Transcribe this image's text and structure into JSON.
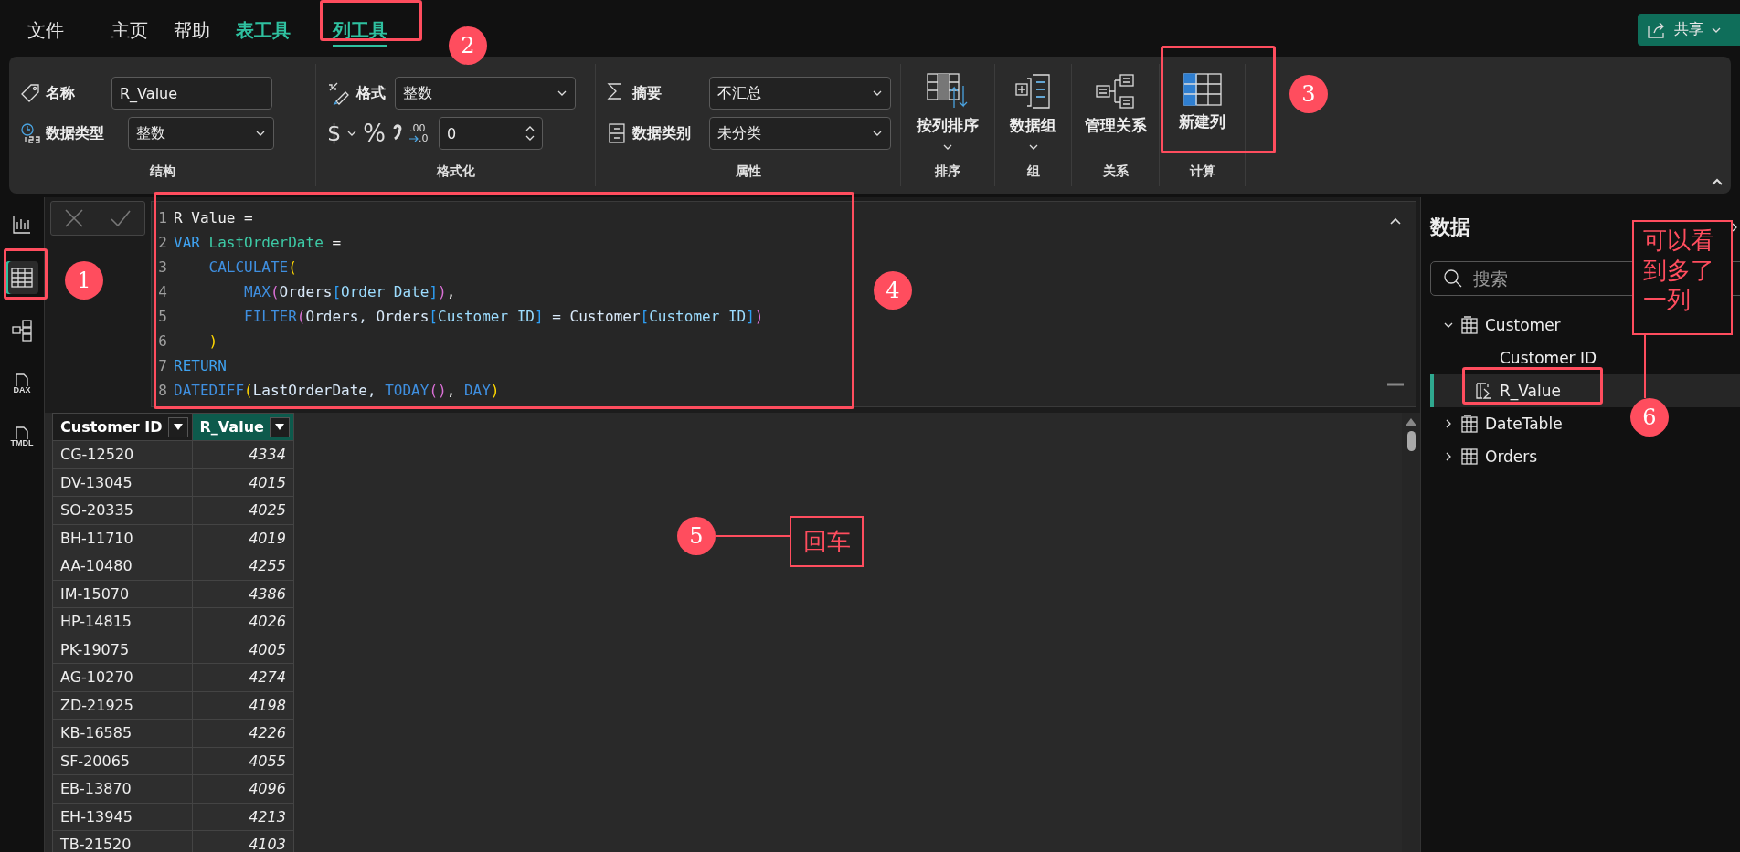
{
  "menu_tabs": [
    {
      "label": "文件",
      "kind": "plain",
      "selected": false
    },
    {
      "label": "主页",
      "kind": "plain",
      "selected": false
    },
    {
      "label": "帮助",
      "kind": "plain",
      "selected": false
    },
    {
      "label": "表工具",
      "kind": "context",
      "selected": false
    },
    {
      "label": "列工具",
      "kind": "context",
      "selected": true
    }
  ],
  "share_button": {
    "label": "共享"
  },
  "ribbon": {
    "structure": {
      "name_label": "名称",
      "name_value": "R_Value",
      "type_label": "数据类型",
      "type_value": "整数",
      "caption": "结构"
    },
    "format": {
      "format_label": "格式",
      "format_value": "整数",
      "currency": "$",
      "percent": "%",
      "decimals_from": ".00",
      "decimals_to": ".0",
      "decimals_value": "0",
      "caption": "格式化"
    },
    "properties": {
      "summary_label": "摘要",
      "summary_value": "不汇总",
      "category_label": "数据类别",
      "category_value": "未分类",
      "caption": "属性"
    },
    "big_buttons": [
      {
        "label": "按列排序",
        "kind": "sort",
        "dropdown": true,
        "caption": "排序"
      },
      {
        "label": "数据组",
        "kind": "group",
        "dropdown": true,
        "caption": "组"
      },
      {
        "label": "管理关系",
        "kind": "relations",
        "dropdown": false,
        "caption": "关系"
      },
      {
        "label": "新建列",
        "kind": "newcolumn",
        "dropdown": false,
        "caption": "计算"
      }
    ]
  },
  "view_rail": [
    {
      "kind": "report",
      "selected": false
    },
    {
      "kind": "table",
      "selected": true
    },
    {
      "kind": "model",
      "selected": false
    },
    {
      "kind": "dax",
      "label": "DAX",
      "selected": false
    },
    {
      "kind": "tmdl",
      "label": "TMDL",
      "selected": false
    }
  ],
  "formula_lines": [
    {
      "number": "1",
      "tokens": [
        {
          "text": "R_Value =",
          "color": "#f0f0f0"
        }
      ]
    },
    {
      "number": "2",
      "tokens": [
        {
          "text": "VAR",
          "color": "#3fa2f0"
        },
        {
          "text": " LastOrderDate",
          "color": "#3dc9a5"
        },
        {
          "text": " =",
          "color": "#f0f0f0"
        }
      ]
    },
    {
      "number": "3",
      "tokens": [
        {
          "text": "    CALCULATE",
          "color": "#3f8fe0"
        },
        {
          "text": "(",
          "color": "#ffd700"
        }
      ]
    },
    {
      "number": "4",
      "tokens": [
        {
          "text": "        MAX",
          "color": "#3f8fe0"
        },
        {
          "text": "(",
          "color": "#da70d6"
        },
        {
          "text": "Orders",
          "color": "#d8e8f8"
        },
        {
          "text": "[",
          "color": "#2e9ff5"
        },
        {
          "text": "Order Date",
          "color": "#9cdcfe"
        },
        {
          "text": "]",
          "color": "#2e9ff5"
        },
        {
          "text": ")",
          "color": "#da70d6"
        },
        {
          "text": ",",
          "color": "#f0f0f0"
        }
      ]
    },
    {
      "number": "5",
      "tokens": [
        {
          "text": "        FILTER",
          "color": "#3f8fe0"
        },
        {
          "text": "(",
          "color": "#da70d6"
        },
        {
          "text": "Orders, Orders",
          "color": "#d8e8f8"
        },
        {
          "text": "[",
          "color": "#2e9ff5"
        },
        {
          "text": "Customer ID",
          "color": "#9cdcfe"
        },
        {
          "text": "]",
          "color": "#2e9ff5"
        },
        {
          "text": " = Customer",
          "color": "#d8e8f8"
        },
        {
          "text": "[",
          "color": "#2e9ff5"
        },
        {
          "text": "Customer ID",
          "color": "#9cdcfe"
        },
        {
          "text": "]",
          "color": "#2e9ff5"
        },
        {
          "text": ")",
          "color": "#da70d6"
        }
      ]
    },
    {
      "number": "6",
      "tokens": [
        {
          "text": "    )",
          "color": "#ffd700"
        }
      ]
    },
    {
      "number": "7",
      "tokens": [
        {
          "text": "RETURN",
          "color": "#3fa2f0"
        }
      ]
    },
    {
      "number": "8",
      "tokens": [
        {
          "text": "DATEDIFF",
          "color": "#3f8fe0"
        },
        {
          "text": "(",
          "color": "#ffd700"
        },
        {
          "text": "LastOrderDate, ",
          "color": "#d8e8f8"
        },
        {
          "text": "TODAY",
          "color": "#3f8fe0"
        },
        {
          "text": "()",
          "color": "#da70d6"
        },
        {
          "text": ", ",
          "color": "#f0f0f0"
        },
        {
          "text": "DAY",
          "color": "#3f8fe0"
        },
        {
          "text": ")",
          "color": "#ffd700"
        }
      ]
    }
  ],
  "table": {
    "columns": [
      {
        "label": "Customer ID",
        "selected": false
      },
      {
        "label": "R_Value",
        "selected": true
      }
    ],
    "rows": [
      [
        "CG-12520",
        "4334"
      ],
      [
        "DV-13045",
        "4015"
      ],
      [
        "SO-20335",
        "4025"
      ],
      [
        "BH-11710",
        "4019"
      ],
      [
        "AA-10480",
        "4255"
      ],
      [
        "IM-15070",
        "4386"
      ],
      [
        "HP-14815",
        "4026"
      ],
      [
        "PK-19075",
        "4005"
      ],
      [
        "AG-10270",
        "4274"
      ],
      [
        "ZD-21925",
        "4198"
      ],
      [
        "KB-16585",
        "4226"
      ],
      [
        "SF-20065",
        "4055"
      ],
      [
        "EB-13870",
        "4096"
      ],
      [
        "EH-13945",
        "4213"
      ],
      [
        "TB-21520",
        "4103"
      ]
    ]
  },
  "data_pane": {
    "title": "数据",
    "search": {
      "placeholder": "搜索"
    },
    "tree": [
      {
        "label": "Customer",
        "kind": "calc_table",
        "expanded": true,
        "children": [
          {
            "label": "Customer ID",
            "kind": "column",
            "selected": false
          },
          {
            "label": "R_Value",
            "kind": "calc_column",
            "selected": true
          }
        ]
      },
      {
        "label": "DateTable",
        "kind": "calc_table",
        "expanded": false
      },
      {
        "label": "Orders",
        "kind": "table",
        "expanded": false
      }
    ]
  },
  "annotations": {
    "badges": [
      "1",
      "2",
      "3",
      "4",
      "5",
      "6"
    ],
    "notes": [
      {
        "text": "回车"
      },
      {
        "text": "可以看到多了一列"
      }
    ]
  }
}
